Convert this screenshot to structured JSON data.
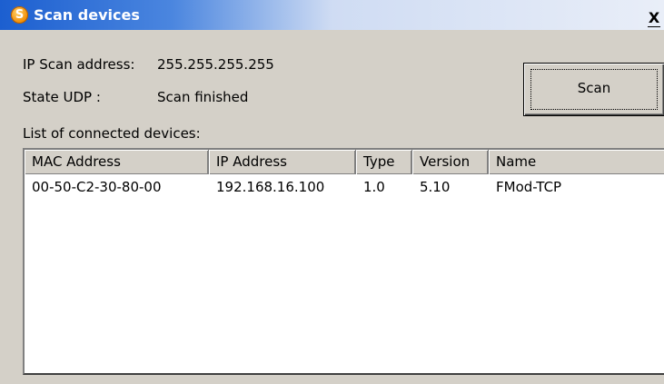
{
  "window": {
    "title": "Scan devices",
    "icon_glyph": "S",
    "close_glyph": "X"
  },
  "ip_scan": {
    "label": "IP Scan address:",
    "value": "255.255.255.255"
  },
  "state_udp": {
    "label": "State UDP :",
    "value": "Scan finished"
  },
  "scan_button": {
    "label": "Scan"
  },
  "list": {
    "label": "List of connected devices:",
    "columns": [
      "MAC Address",
      "IP Address",
      "Type",
      "Version",
      "Name"
    ],
    "rows": [
      [
        "00-50-C2-30-80-00",
        "192.168.16.100",
        "1.0",
        "5.10",
        "FMod-TCP"
      ]
    ]
  },
  "colors": {
    "title_start": "#1c5fd0",
    "title_end": "#e9eef8",
    "face": "#d4d0c8"
  },
  "icons": {
    "app": "app-icon",
    "close": "close-icon"
  }
}
